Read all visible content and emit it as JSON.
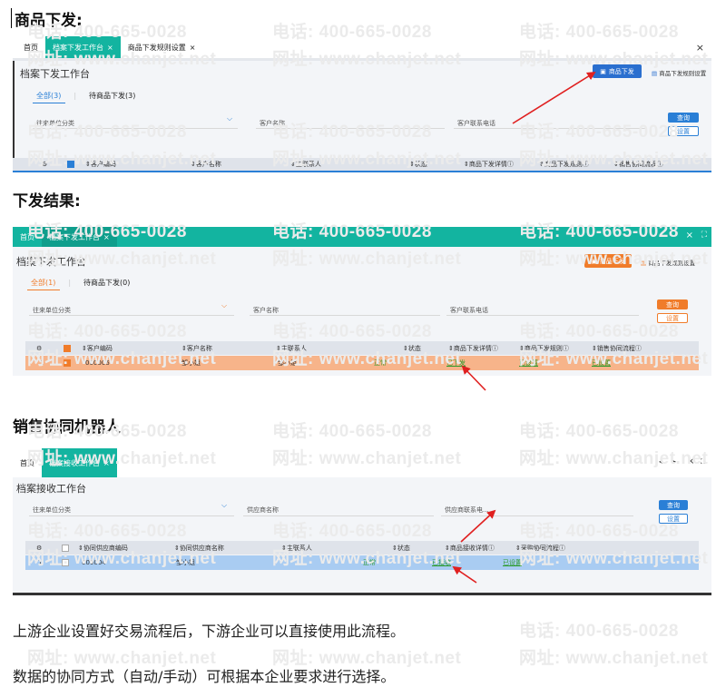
{
  "watermark": {
    "phone": "电话: 400-665-0028",
    "site": "网址: www.chanjet.net"
  },
  "headings": {
    "h1": "商品下发:",
    "h2": "下发结果:",
    "h3": "销售协同机器人"
  },
  "shot1": {
    "tabs": [
      {
        "label": "首页"
      },
      {
        "label": "档案下发工作台"
      },
      {
        "label": "商品下发规则设置"
      }
    ],
    "close": "×",
    "title": "档案下发工作台",
    "distribute_button": "商品下发",
    "rule_link": "商品下发规则设置",
    "subtabs": [
      "全部(3)",
      "待商品下发(3)"
    ],
    "fields": {
      "category": "往来单位分类",
      "name": "客户名称",
      "phone": "客户联系电话"
    },
    "query": "查询",
    "settings": "设置",
    "columns": [
      "客户编码",
      "客户名称",
      "主联系人",
      "状态",
      "商品下发详情",
      "商品下发规则",
      "销售协同流程"
    ]
  },
  "shot2": {
    "tabs": [
      {
        "label": "首页"
      },
      {
        "label": "档案下发工作台"
      }
    ],
    "title": "档案下发工作台",
    "distribute_button": "商品下发",
    "rule_link": "商品下发规则设置",
    "subtabs": [
      "全部(1)",
      "待商品下发(0)"
    ],
    "fields": {
      "category": "往来单位分类",
      "name": "客户名称",
      "phone": "客户联系电话"
    },
    "query": "查询",
    "settings": "设置",
    "columns": [
      "客户编码",
      "客户名称",
      "主联系人",
      "状态",
      "商品下发详情",
      "商品下发规则",
      "销售协同流程"
    ],
    "row": {
      "index": "1",
      "code": "000006",
      "name": "邹小姐",
      "contact": "邹小姐",
      "status": "正常",
      "detail": "已下发",
      "rule": "已设置",
      "flow": "已设置"
    }
  },
  "shot3": {
    "tabs": [
      {
        "label": "首页"
      },
      {
        "label": "档案接收工作台"
      }
    ],
    "title": "档案接收工作台",
    "fields": {
      "category": "往来单位分类",
      "name": "供应商名称",
      "phone": "供应商联系电..."
    },
    "query": "查询",
    "settings": "设置",
    "columns": [
      "协同供应商编码",
      "协同供应商名称",
      "主联系人",
      "状态",
      "商品接收详情",
      "采购协同流程"
    ],
    "row": {
      "index": "1",
      "code": "000004",
      "name": "邹小姐",
      "contact": "",
      "status": "正常",
      "detail": "已接收",
      "flow": "已设置"
    }
  },
  "paragraphs": {
    "p1": "上游企业设置好交易流程后，下游企业可以直接使用此流程。",
    "p2": "数据的协同方式（自动/手动）可根据本企业要求进行选择。"
  },
  "colors": {
    "teal": "#13b4a0",
    "orange": "#f07c2a",
    "blue": "#2a7fd6",
    "red_arrow": "#e02020",
    "row_orange": "#f7b48a",
    "row_blue": "#a9ccf2"
  }
}
